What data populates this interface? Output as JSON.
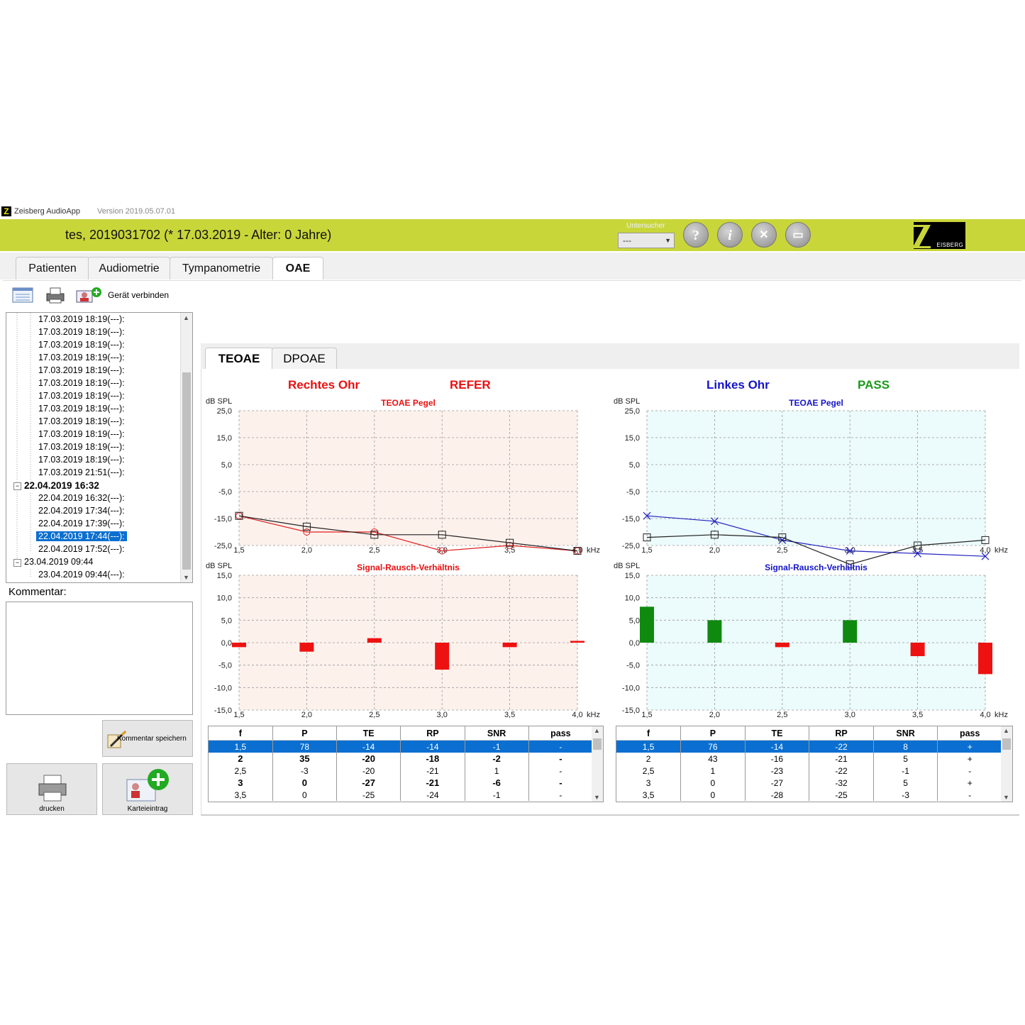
{
  "window": {
    "logo_letter": "Z",
    "app_title": "Zeisberg AudioApp",
    "version": "Version 2019.05.07.01",
    "brand_name": "EISBERG"
  },
  "header": {
    "patient": "tes, 2019031702 (* 17.03.2019 - Alter: 0 Jahre)",
    "examiner_label": "Untersucher",
    "examiner_value": "---",
    "buttons": [
      {
        "name": "help",
        "glyph": "?"
      },
      {
        "name": "info",
        "glyph": "i"
      },
      {
        "name": "settings",
        "glyph": "✕"
      },
      {
        "name": "folder",
        "glyph": "▭"
      }
    ]
  },
  "main_tabs": [
    "Patienten",
    "Audiometrie",
    "Tympanometrie",
    "OAE"
  ],
  "main_tab_active": "OAE",
  "toolbar": {
    "connect_label": "Gerät verbinden"
  },
  "tree": [
    {
      "label": "17.03.2019 18:19(---):",
      "level": 2
    },
    {
      "label": "17.03.2019 18:19(---):",
      "level": 2
    },
    {
      "label": "17.03.2019 18:19(---):",
      "level": 2
    },
    {
      "label": "17.03.2019 18:19(---):",
      "level": 2
    },
    {
      "label": "17.03.2019 18:19(---):",
      "level": 2
    },
    {
      "label": "17.03.2019 18:19(---):",
      "level": 2
    },
    {
      "label": "17.03.2019 18:19(---):",
      "level": 2
    },
    {
      "label": "17.03.2019 18:19(---):",
      "level": 2
    },
    {
      "label": "17.03.2019 18:19(---):",
      "level": 2
    },
    {
      "label": "17.03.2019 18:19(---):",
      "level": 2
    },
    {
      "label": "17.03.2019 18:19(---):",
      "level": 2
    },
    {
      "label": "17.03.2019 18:19(---):",
      "level": 2
    },
    {
      "label": "17.03.2019 21:51(---):",
      "level": 2
    },
    {
      "label": "22.04.2019 16:32",
      "level": 1,
      "bold": true
    },
    {
      "label": "22.04.2019 16:32(---):",
      "level": 2
    },
    {
      "label": "22.04.2019 17:34(---):",
      "level": 2
    },
    {
      "label": "22.04.2019 17:39(---):",
      "level": 2
    },
    {
      "label": "22.04.2019 17:44(---):",
      "level": 2,
      "selected": true
    },
    {
      "label": "22.04.2019 17:52(---):",
      "level": 2
    },
    {
      "label": "23.04.2019 09:44",
      "level": 1
    },
    {
      "label": "23.04.2019 09:44(---):",
      "level": 2
    }
  ],
  "comment_label": "Kommentar:",
  "buttons": {
    "save_comment": "Kommentar speichern",
    "print": "drucken",
    "record": "Karteieintrag"
  },
  "sub_tabs": [
    "TEOAE",
    "DPOAE"
  ],
  "sub_tab_active": "TEOAE",
  "right_ear": {
    "label": "Rechtes Ohr",
    "result": "REFER",
    "color": "#e81010"
  },
  "left_ear": {
    "label": "Linkes Ohr",
    "result": "PASS",
    "result_color": "#1a9a1a",
    "color": "#1414c8"
  },
  "chart_data": [
    {
      "type": "line",
      "title": "TEOAE Pegel",
      "ear": "right",
      "ylabel": "dB SPL",
      "xlabel": "kHz",
      "x": [
        1.5,
        2.0,
        2.5,
        3.0,
        3.5,
        4.0
      ],
      "x_ticks": [
        "1,5",
        "2,0",
        "2,5",
        "3,0",
        "3,5",
        "4,0"
      ],
      "y_ticks": [
        "25,0",
        "15,0",
        "5,0",
        "-5,0",
        "-15,0",
        "-25,0"
      ],
      "ylim": [
        -25,
        25
      ],
      "background": "#fdf1ec",
      "series": [
        {
          "values": [
            -14,
            -20,
            -20,
            -27,
            -25,
            -27
          ],
          "color": "#e02020",
          "marker": "circle"
        },
        {
          "values": [
            -14,
            -18,
            -21,
            -21,
            -24,
            -27
          ],
          "color": "#202020",
          "marker": "square"
        }
      ]
    },
    {
      "type": "bar",
      "title": "Signal-Rausch-Verhältnis",
      "ear": "right",
      "ylabel": "dB SPL",
      "xlabel": "kHz",
      "x": [
        1.5,
        2.0,
        2.5,
        3.0,
        3.5,
        4.0
      ],
      "x_ticks": [
        "1,5",
        "2,0",
        "2,5",
        "3,0",
        "3,5",
        "4,0"
      ],
      "y_ticks": [
        "15,0",
        "10,0",
        "5,0",
        "0,0",
        "-5,0",
        "-10,0",
        "-15,0"
      ],
      "ylim": [
        -15,
        15
      ],
      "background": "#fdf1ec",
      "values": [
        -1,
        -2,
        1,
        -6,
        -1,
        0.4
      ],
      "colors": [
        "#ee1111",
        "#ee1111",
        "#ee1111",
        "#ee1111",
        "#ee1111",
        "#ee1111"
      ]
    },
    {
      "type": "line",
      "title": "TEOAE Pegel",
      "ear": "left",
      "ylabel": "dB SPL",
      "xlabel": "kHz",
      "x": [
        1.5,
        2.0,
        2.5,
        3.0,
        3.5,
        4.0
      ],
      "x_ticks": [
        "1,5",
        "2,0",
        "2,5",
        "3,0",
        "3,5",
        "4,0"
      ],
      "y_ticks": [
        "25,0",
        "15,0",
        "5,0",
        "-5,0",
        "-15,0",
        "-25,0"
      ],
      "ylim": [
        -25,
        25
      ],
      "background": "#ecfbfb",
      "series": [
        {
          "values": [
            -14,
            -16,
            -23,
            -27,
            -28,
            -29
          ],
          "color": "#2020c0",
          "marker": "cross"
        },
        {
          "values": [
            -22,
            -21,
            -22,
            -32,
            -25,
            -23
          ],
          "color": "#202020",
          "marker": "square"
        }
      ]
    },
    {
      "type": "bar",
      "title": "Signal-Rausch-Verhältnis",
      "ear": "left",
      "ylabel": "dB SPL",
      "xlabel": "kHz",
      "x": [
        1.5,
        2.0,
        2.5,
        3.0,
        3.5,
        4.0
      ],
      "x_ticks": [
        "1,5",
        "2,0",
        "2,5",
        "3,0",
        "3,5",
        "4,0"
      ],
      "y_ticks": [
        "15,0",
        "10,0",
        "5,0",
        "0,0",
        "-5,0",
        "-10,0",
        "-15,0"
      ],
      "ylim": [
        -15,
        15
      ],
      "background": "#ecfbfb",
      "values": [
        8,
        5,
        -1,
        5,
        -3,
        -7
      ],
      "colors": [
        "#0f8a0f",
        "#0f8a0f",
        "#ee1111",
        "#0f8a0f",
        "#ee1111",
        "#ee1111"
      ]
    }
  ],
  "right_table": {
    "columns": [
      "f",
      "P",
      "TE",
      "RP",
      "SNR",
      "pass"
    ],
    "rows": [
      {
        "cells": [
          "1,5",
          "78",
          "-14",
          "-14",
          "-1",
          "-"
        ],
        "selected": true
      },
      {
        "cells": [
          "2",
          "35",
          "-20",
          "-18",
          "-2",
          "-"
        ],
        "bold": true
      },
      {
        "cells": [
          "2,5",
          "-3",
          "-20",
          "-21",
          "1",
          "-"
        ]
      },
      {
        "cells": [
          "3",
          "0",
          "-27",
          "-21",
          "-6",
          "-"
        ],
        "bold": true
      },
      {
        "cells": [
          "3,5",
          "0",
          "-25",
          "-24",
          "-1",
          "-"
        ]
      }
    ]
  },
  "left_table": {
    "columns": [
      "f",
      "P",
      "TE",
      "RP",
      "SNR",
      "pass"
    ],
    "rows": [
      {
        "cells": [
          "1,5",
          "76",
          "-14",
          "-22",
          "8",
          "+"
        ],
        "selected": true
      },
      {
        "cells": [
          "2",
          "43",
          "-16",
          "-21",
          "5",
          "+"
        ]
      },
      {
        "cells": [
          "2,5",
          "1",
          "-23",
          "-22",
          "-1",
          "-"
        ]
      },
      {
        "cells": [
          "3",
          "0",
          "-27",
          "-32",
          "5",
          "+"
        ]
      },
      {
        "cells": [
          "3,5",
          "0",
          "-28",
          "-25",
          "-3",
          "-"
        ]
      }
    ]
  }
}
